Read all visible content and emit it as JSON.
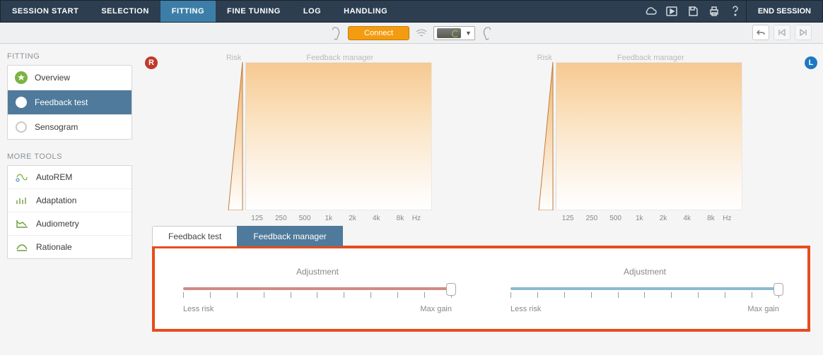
{
  "topnav": {
    "items": [
      "SESSION START",
      "SELECTION",
      "FITTING",
      "FINE TUNING",
      "LOG",
      "HANDLING"
    ],
    "active_index": 2,
    "end_session": "END SESSION"
  },
  "toolbar": {
    "connect_label": "Connect"
  },
  "sidebar": {
    "fitting_heading": "FITTING",
    "fitting_items": [
      {
        "label": "Overview"
      },
      {
        "label": "Feedback test"
      },
      {
        "label": "Sensogram"
      }
    ],
    "fitting_active_index": 1,
    "more_heading": "MORE TOOLS",
    "more_items": [
      {
        "label": "AutoREM"
      },
      {
        "label": "Adaptation"
      },
      {
        "label": "Audiometry"
      },
      {
        "label": "Rationale"
      }
    ]
  },
  "badges": {
    "right": "R",
    "left": "L"
  },
  "chart_common": {
    "risk_label": "Risk",
    "fb_label": "Feedback manager",
    "ticks": [
      "125",
      "250",
      "500",
      "1k",
      "2k",
      "4k",
      "8k"
    ],
    "unit": "Hz"
  },
  "tabs": {
    "items": [
      "Feedback test",
      "Feedback manager"
    ],
    "active_index": 1
  },
  "adjustment": {
    "title": "Adjustment",
    "left_label": "Less risk",
    "right_label": "Max gain",
    "tick_count": 11,
    "slider_positions": {
      "right_ear": 1.0,
      "left_ear": 1.0
    }
  },
  "chart_data": [
    {
      "type": "area",
      "side": "right",
      "title": "Feedback manager",
      "xlabel": "Hz",
      "x_ticks": [
        125,
        250,
        500,
        1000,
        2000,
        4000,
        8000
      ],
      "risk_triangle": {
        "orientation": "vertical",
        "fill": "gradient-orange"
      },
      "series": []
    },
    {
      "type": "area",
      "side": "left",
      "title": "Feedback manager",
      "xlabel": "Hz",
      "x_ticks": [
        125,
        250,
        500,
        1000,
        2000,
        4000,
        8000
      ],
      "risk_triangle": {
        "orientation": "vertical",
        "fill": "gradient-orange"
      },
      "series": []
    }
  ]
}
